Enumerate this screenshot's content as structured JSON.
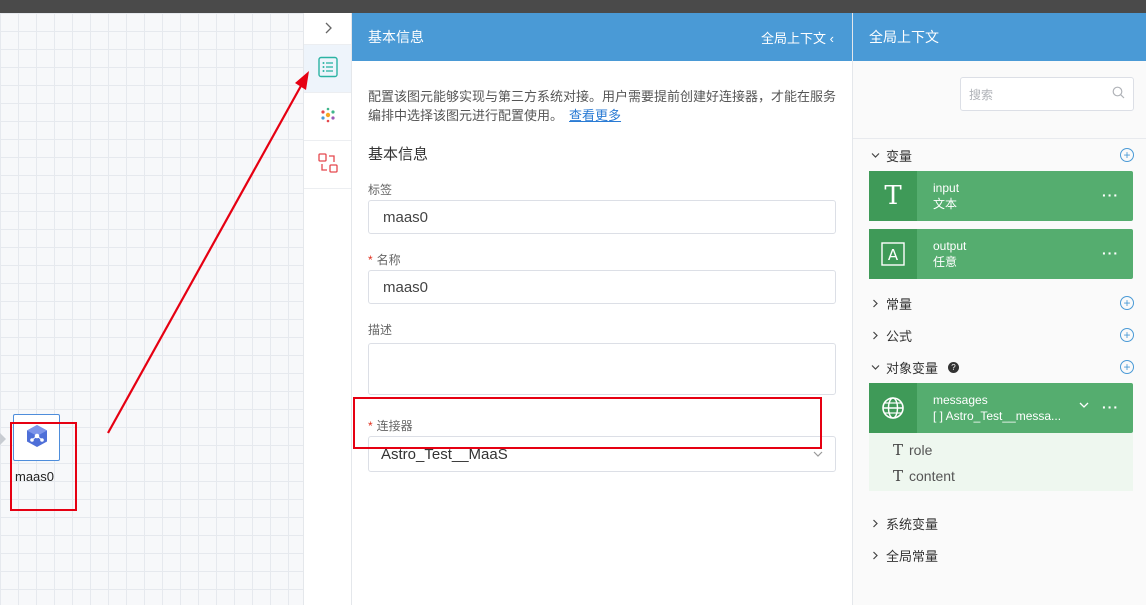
{
  "canvas": {
    "node_label": "maas0"
  },
  "strip": {
    "toggle_icon": "chevron-right-icon",
    "items": [
      {
        "icon": "list-icon"
      },
      {
        "icon": "dots-icon"
      },
      {
        "icon": "swap-icon"
      }
    ]
  },
  "basic_panel": {
    "title": "基本信息",
    "context_toggle": "全局上下文 ‹",
    "description": "配置该图元能够实现与第三方系统对接。用户需要提前创建好连接器，才能在服务编排中选择该图元进行配置使用。",
    "learn_more": "查看更多",
    "section_title": "基本信息",
    "fields": {
      "tag_label": "标签",
      "tag_value": "maas0",
      "name_label": "名称",
      "name_value": "maas0",
      "desc_label": "描述",
      "connector_label": "连接器",
      "connector_value": "Astro_Test__MaaS"
    }
  },
  "context_panel": {
    "title": "全局上下文",
    "search_placeholder": "搜索",
    "groups": {
      "variables": "变量",
      "constants": "常量",
      "formulas": "公式",
      "object_variables": "对象变量",
      "system_variables": "系统变量",
      "global_constants": "全局常量"
    },
    "variables": [
      {
        "name": "input",
        "type": "文本",
        "icon_glyph": "T"
      },
      {
        "name": "output",
        "type": "任意",
        "icon_glyph": "A"
      }
    ],
    "object_variable": {
      "name": "messages",
      "type": "[ ] Astro_Test__messa...",
      "children": [
        "role",
        "content"
      ]
    },
    "accent_color": "#4a9ad6",
    "variable_color": "#55ad6f"
  }
}
